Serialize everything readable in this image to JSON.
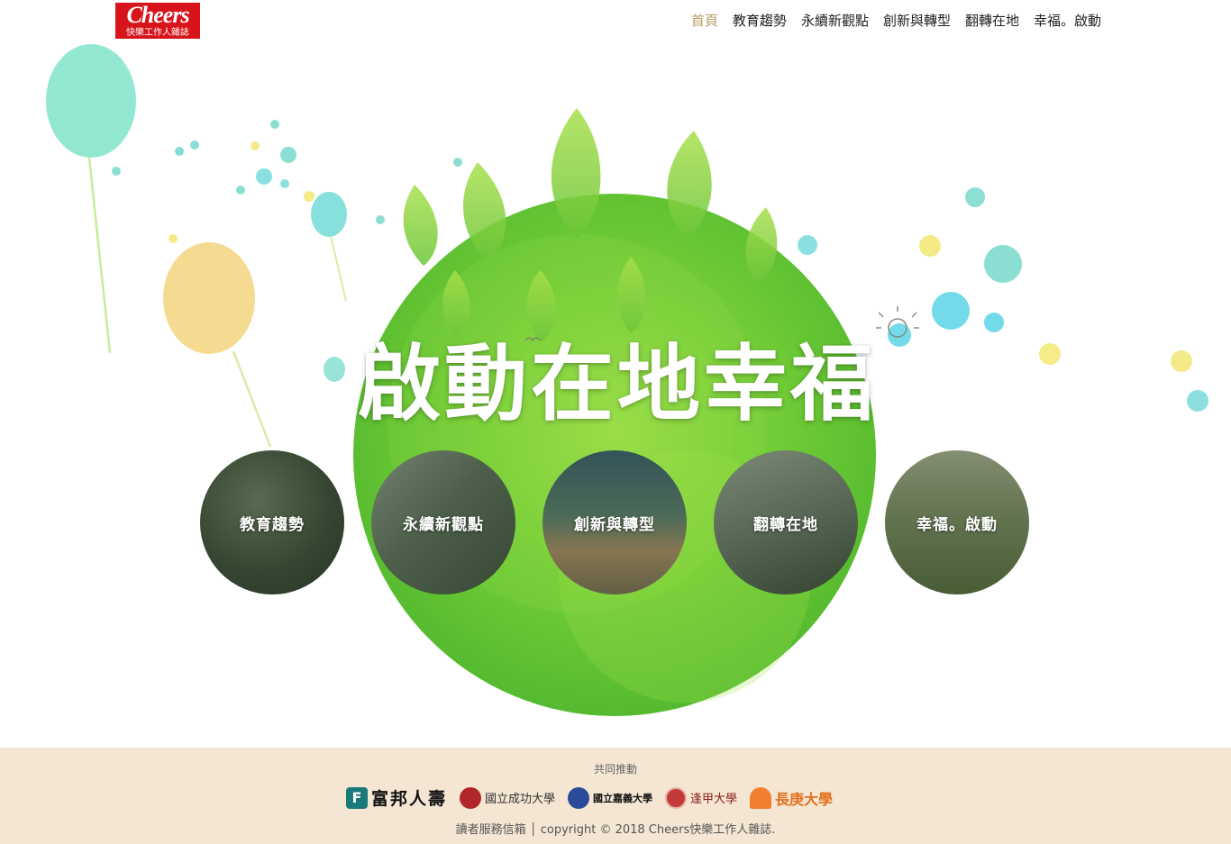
{
  "header": {
    "logo_word": "Cheers",
    "logo_sub": "快樂工作人雜誌",
    "nav": [
      {
        "label": "首頁",
        "active": true
      },
      {
        "label": "教育趨勢",
        "active": false
      },
      {
        "label": "永續新觀點",
        "active": false
      },
      {
        "label": "創新與轉型",
        "active": false
      },
      {
        "label": "翻轉在地",
        "active": false
      },
      {
        "label": "幸福。啟動",
        "active": false
      }
    ]
  },
  "hero": {
    "title": "啟動在地幸福",
    "circles": [
      {
        "label": "教育趨勢"
      },
      {
        "label": "永續新觀點"
      },
      {
        "label": "創新與轉型"
      },
      {
        "label": "翻轉在地"
      },
      {
        "label": "幸福。啟動"
      }
    ]
  },
  "footer": {
    "caption": "共同推動",
    "partners": [
      {
        "mark": "F",
        "name": "富邦人壽"
      },
      {
        "name": "國立成功大學"
      },
      {
        "name": "國立嘉義大學"
      },
      {
        "name": "逢甲大學"
      },
      {
        "name": "長庚大學"
      }
    ],
    "copyright": "讀者服務信箱 │ copyright © 2018 Cheers快樂工作人雜誌."
  },
  "colors": {
    "accent_nav": "#b79b62",
    "logo_red": "#d7141a",
    "green_circle": "#74d03a",
    "footer_bg": "#f4e6d2"
  }
}
